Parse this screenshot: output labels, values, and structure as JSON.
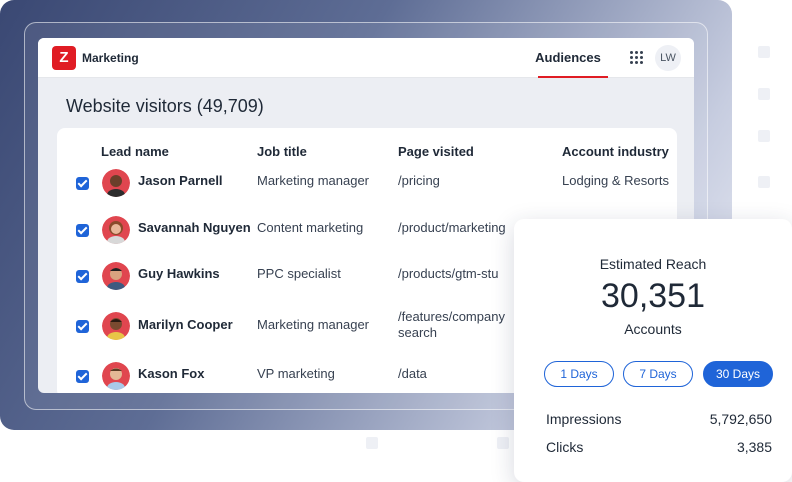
{
  "app": {
    "brand": "Marketing",
    "logo_letter": "Z",
    "nav_tab": "Audiences",
    "user_initials": "LW",
    "accent_color": "#e01c24"
  },
  "page": {
    "title": "Website visitors (49,709)"
  },
  "table": {
    "headers": [
      "Lead name",
      "Job title",
      "Page visited",
      "Account industry"
    ],
    "rows": [
      {
        "name": "Jason Parnell",
        "title": "Marketing manager",
        "page": "/pricing",
        "industry": "Lodging & Resorts",
        "checked": true
      },
      {
        "name": "Savannah Nguyen",
        "title": "Content marketing",
        "page": "/product/marketing",
        "industry": "",
        "checked": true
      },
      {
        "name": "Guy Hawkins",
        "title": "PPC specialist",
        "page": "/products/gtm-stu",
        "industry": "",
        "checked": true
      },
      {
        "name": "Marilyn Cooper",
        "title": "Marketing manager",
        "page": "/features/company search",
        "industry": "",
        "checked": true
      },
      {
        "name": "Kason Fox",
        "title": "VP marketing",
        "page": "/data",
        "industry": "",
        "checked": true
      }
    ]
  },
  "reach": {
    "title": "Estimated Reach",
    "value": "30,351",
    "unit": "Accounts",
    "ranges": [
      "1 Days",
      "7 Days",
      "30 Days"
    ],
    "active_range": "30 Days",
    "metrics": [
      {
        "label": "Impressions",
        "value": "5,792,650"
      },
      {
        "label": "Clicks",
        "value": "3,385"
      }
    ],
    "primary_color": "#1f64d8"
  }
}
